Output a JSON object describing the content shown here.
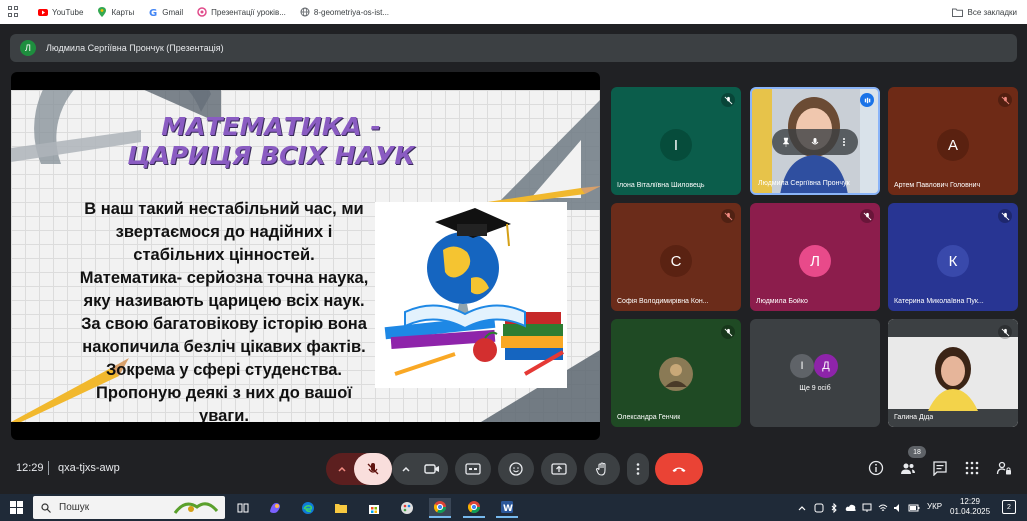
{
  "bookmarks": {
    "items": [
      {
        "label": "YouTube",
        "icon": "youtube-icon",
        "color": "#ff0000"
      },
      {
        "label": "Карты",
        "icon": "maps-pin-icon",
        "color": "#34a853"
      },
      {
        "label": "Gmail",
        "icon": "google-g-icon",
        "color": "#4285f4"
      },
      {
        "label": "Презентації уроків...",
        "icon": "flower-icon",
        "color": "#e04a8a"
      },
      {
        "label": "8-geometriya-os-ist...",
        "icon": "globe-icon",
        "color": "#5f6368"
      }
    ],
    "all_bookmarks": "Все закладки"
  },
  "presenter": {
    "avatar_letter": "Л",
    "name": "Людмила Сергіївна Прончук (Презентація)"
  },
  "slide": {
    "title_line1": "МАТЕМАТИКА -",
    "title_line2": "ЦАРИЦЯ ВСІХ НАУК",
    "body_lines": [
      "В наш такий нестабільний час, ми",
      "звертаємося до надійних і",
      "стабільних цінностей.",
      "Математика- серйозна точна наука,",
      "яку називають царицею всіх наук.",
      "За свою багатовікову історію вона",
      "накопичила безліч цікавих фактів.",
      "Зокрема у сфері студенства.",
      "Пропоную деякі з них до вашої",
      "уваги."
    ]
  },
  "participants": [
    {
      "name": "Ілона Віталіївна Шиловець",
      "letter": "І",
      "bg": "#0b5d4b",
      "avatar_bg": "#064c3b",
      "muted": true
    },
    {
      "name": "Людмила Сергіївна Прончук",
      "letter": "",
      "bg": "#c9cfd6",
      "avatar_bg": "",
      "muted": false,
      "video": true,
      "speaking": true
    },
    {
      "name": "Артем Павлович Головнич",
      "letter": "А",
      "bg": "#6e2a16",
      "avatar_bg": "#5a2110",
      "muted": true
    },
    {
      "name": "Софія Володимирівна Кон...",
      "letter": "С",
      "bg": "#6b2c1a",
      "avatar_bg": "#5a2212",
      "muted": true
    },
    {
      "name": "Людмила Бойко",
      "letter": "Л",
      "bg": "#8c1d4c",
      "avatar_bg": "#e84a8a",
      "muted": true
    },
    {
      "name": "Катерина Миколаївна Пук...",
      "letter": "К",
      "bg": "#283593",
      "avatar_bg": "#3949ab",
      "muted": true
    },
    {
      "name": "Олександра Генчик",
      "letter": "",
      "bg": "#1f4a24",
      "avatar_bg": "#8a7a55",
      "muted": true,
      "photo": true
    },
    {
      "name": "Ще 9 осіб",
      "letter": "",
      "bg": "#3c4043",
      "avatar_bg": "",
      "muted": false,
      "more": true,
      "more_letters": [
        "І",
        "Д"
      ]
    },
    {
      "name": "Галина Діда",
      "letter": "",
      "bg": "#e6e6e6",
      "avatar_bg": "",
      "muted": true,
      "video": true
    }
  ],
  "meeting": {
    "time": "12:29",
    "code": "qxa-tjxs-awp",
    "people_count": "18"
  },
  "taskbar": {
    "search_placeholder": "Пошук",
    "lang": "УКР",
    "clock_time": "12:29",
    "clock_date": "01.04.2025",
    "notifications": "2"
  },
  "colors": {
    "meet_bg": "#202124",
    "control_bg": "#3c4043",
    "end_call": "#ea4335",
    "title_purple": "#8a5cc2"
  }
}
